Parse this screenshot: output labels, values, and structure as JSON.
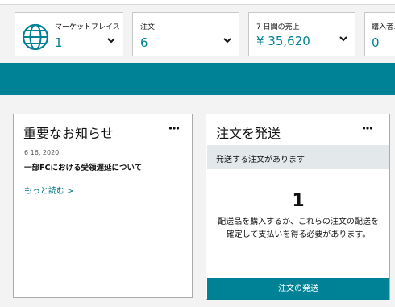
{
  "stats": [
    {
      "label": "マーケットプレイス",
      "value": "1"
    },
    {
      "label": "注文",
      "value": "6"
    },
    {
      "label": "7 日間の売上",
      "value": "¥ 35,620"
    },
    {
      "label": "購入者メ",
      "value": "0"
    }
  ],
  "icons": {
    "globe": "globe-icon",
    "chevron": "chevron-down-icon",
    "more": "more-options-icon"
  },
  "colors": {
    "accent": "#008296",
    "link": "#007185",
    "banner": "#008296"
  },
  "news": {
    "title": "重要なお知らせ",
    "date": "6 16, 2020",
    "headline": "一部FCにおける受領遅延について",
    "read_more": "もっと読む >"
  },
  "ship": {
    "title": "注文を発送",
    "subtitle": "発送する注文があります",
    "count": "1",
    "description": "配送品を購入するか、これらの注文の配送を確定して支払いを得る必要があります。",
    "button_label": "注文の発送"
  }
}
